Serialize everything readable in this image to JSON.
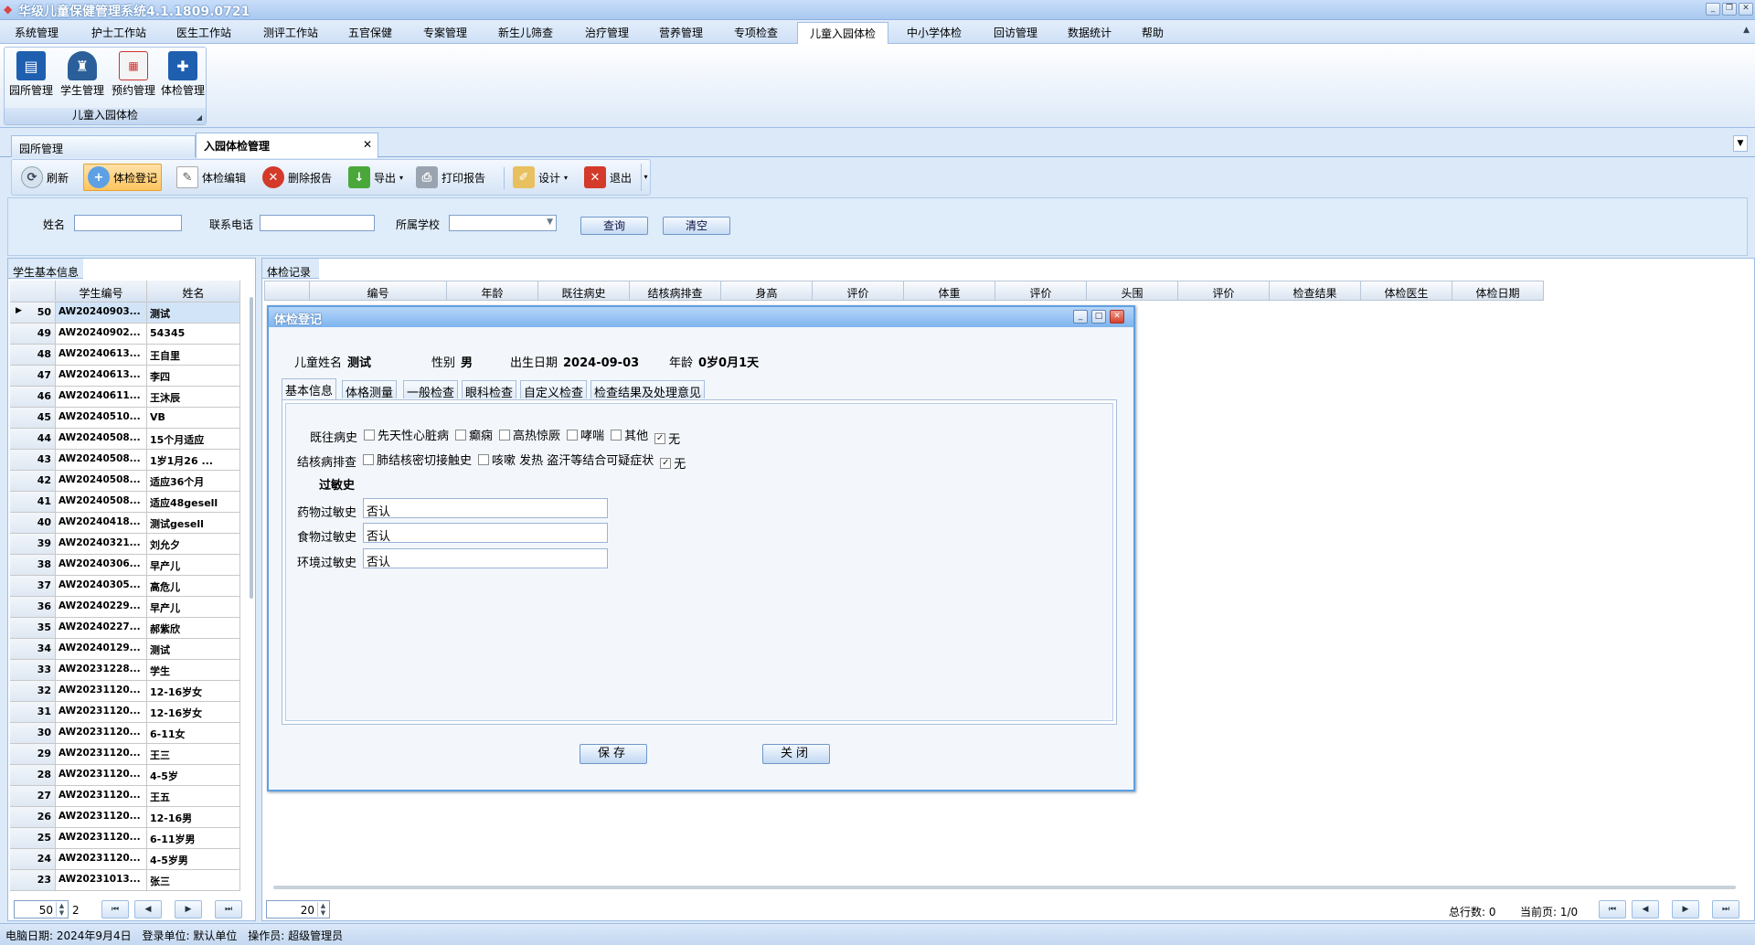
{
  "app": {
    "title": "华级儿童保健管理系统4.1.1809.0721"
  },
  "menu": {
    "items": [
      "系统管理",
      "护士工作站",
      "医生工作站",
      "测评工作站",
      "五官保健",
      "专案管理",
      "新生儿筛查",
      "治疗管理",
      "营养管理",
      "专项检查",
      "儿童入园体检",
      "中小学体检",
      "回访管理",
      "数据统计",
      "帮助"
    ],
    "active": "儿童入园体检"
  },
  "ribbon": {
    "buttons": [
      "园所管理",
      "学生管理",
      "预约管理",
      "体检管理"
    ],
    "group_label": "儿童入园体检"
  },
  "doc_tabs": {
    "tabs": [
      "园所管理",
      "入园体检管理"
    ],
    "active": "入园体检管理"
  },
  "toolbar": {
    "refresh": "刷新",
    "register": "体检登记",
    "edit": "体检编辑",
    "delete": "删除报告",
    "export": "导出",
    "print": "打印报告",
    "design": "设计",
    "exit": "退出"
  },
  "search": {
    "name_label": "姓名",
    "name_value": "",
    "phone_label": "联系电话",
    "phone_value": "",
    "school_label": "所属学校",
    "school_value": "",
    "query_button": "查询",
    "clear_button": "清空"
  },
  "left_panel": {
    "title": "学生基本信息",
    "columns": [
      "学生编号",
      "姓名"
    ],
    "rows": [
      {
        "no": "50",
        "id": "AW20240903...",
        "name": "测试"
      },
      {
        "no": "49",
        "id": "AW20240902...",
        "name": "54345"
      },
      {
        "no": "48",
        "id": "AW20240613...",
        "name": "王自里"
      },
      {
        "no": "47",
        "id": "AW20240613...",
        "name": "李四"
      },
      {
        "no": "46",
        "id": "AW20240611...",
        "name": "王沐辰"
      },
      {
        "no": "45",
        "id": "AW20240510...",
        "name": "VB"
      },
      {
        "no": "44",
        "id": "AW20240508...",
        "name": "15个月适应"
      },
      {
        "no": "43",
        "id": "AW20240508...",
        "name": "1岁1月26 ..."
      },
      {
        "no": "42",
        "id": "AW20240508...",
        "name": "适应36个月"
      },
      {
        "no": "41",
        "id": "AW20240508...",
        "name": "适应48gesell"
      },
      {
        "no": "40",
        "id": "AW20240418...",
        "name": "测试gesell"
      },
      {
        "no": "39",
        "id": "AW20240321...",
        "name": "刘允夕"
      },
      {
        "no": "38",
        "id": "AW20240306...",
        "name": "早产儿"
      },
      {
        "no": "37",
        "id": "AW20240305...",
        "name": "高危儿"
      },
      {
        "no": "36",
        "id": "AW20240229...",
        "name": "早产儿"
      },
      {
        "no": "35",
        "id": "AW20240227...",
        "name": "郝紫欣"
      },
      {
        "no": "34",
        "id": "AW20240129...",
        "name": "测试"
      },
      {
        "no": "33",
        "id": "AW20231228...",
        "name": "学生"
      },
      {
        "no": "32",
        "id": "AW20231120...",
        "name": "12-16岁女"
      },
      {
        "no": "31",
        "id": "AW20231120...",
        "name": "12-16岁女"
      },
      {
        "no": "30",
        "id": "AW20231120...",
        "name": "6-11女"
      },
      {
        "no": "29",
        "id": "AW20231120...",
        "name": "王三"
      },
      {
        "no": "28",
        "id": "AW20231120...",
        "name": "4-5岁"
      },
      {
        "no": "27",
        "id": "AW20231120...",
        "name": "王五"
      },
      {
        "no": "26",
        "id": "AW20231120...",
        "name": "12-16男"
      },
      {
        "no": "25",
        "id": "AW20231120...",
        "name": "6-11岁男"
      },
      {
        "no": "24",
        "id": "AW20231120...",
        "name": "4-5岁男"
      },
      {
        "no": "23",
        "id": "AW20231013...",
        "name": "张三"
      }
    ],
    "page_size": "50",
    "page_count": "2"
  },
  "right_panel": {
    "title": "体检记录",
    "columns": [
      "编号",
      "年龄",
      "既往病史",
      "结核病排查",
      "身高",
      "评价",
      "体重",
      "评价",
      "头围",
      "评价",
      "检查结果",
      "体检医生",
      "体检日期"
    ],
    "page_size": "20",
    "total_label": "总行数: 0",
    "current_page_label": "当前页: 1/0"
  },
  "dialog": {
    "title": "体检登记",
    "child_name_label": "儿童姓名",
    "child_name": "测试",
    "gender_label": "性别",
    "gender": "男",
    "birth_label": "出生日期",
    "birth": "2024-09-03",
    "age_label": "年龄",
    "age": "0岁0月1天",
    "tabs": [
      "基本信息",
      "体格测量",
      "一般检查",
      "眼科检查",
      "自定义检查",
      "检查结果及处理意见"
    ],
    "active_tab": "基本信息",
    "history_label": "既往病史",
    "history_options": [
      {
        "label": "先天性心脏病",
        "checked": false
      },
      {
        "label": "癫痫",
        "checked": false
      },
      {
        "label": "高热惊厥",
        "checked": false
      },
      {
        "label": "哮喘",
        "checked": false
      },
      {
        "label": "其他",
        "checked": false
      },
      {
        "label": "无",
        "checked": true
      }
    ],
    "tb_label": "结核病排查",
    "tb_options": [
      {
        "label": "肺结核密切接触史",
        "checked": false
      },
      {
        "label": "咳嗽 发热 盗汗等结合可疑症状",
        "checked": false
      },
      {
        "label": "无",
        "checked": true
      }
    ],
    "allergy_heading": "过敏史",
    "drug_allergy_label": "药物过敏史",
    "drug_allergy_value": "否认",
    "food_allergy_label": "食物过敏史",
    "food_allergy_value": "否认",
    "env_allergy_label": "环境过敏史",
    "env_allergy_value": "否认",
    "save_button": "保存",
    "close_button": "关闭"
  },
  "status_bar": {
    "date_label": "电脑日期:",
    "date": "2024年9月4日",
    "unit_label": "登录单位:",
    "unit": "默认单位",
    "operator_label": "操作员:",
    "operator": "超级管理员"
  },
  "colors": {
    "accent": "#5f9fe0",
    "ribbon_blue": "#1f5fb0",
    "active_button": "#ffc45e",
    "delete_red": "#d33a2a",
    "export_green": "#4aa83a"
  },
  "icons": {
    "app": "app-logo-icon",
    "ribbon": [
      "kindergarten-book-icon",
      "student-cap-icon",
      "calendar-icon",
      "medical-kit-icon"
    ],
    "toolbar": [
      "refresh-icon",
      "plus-circle-icon",
      "pencil-edit-icon",
      "delete-x-icon",
      "download-arrow-icon",
      "printer-icon",
      "design-pen-icon",
      "exit-icon"
    ]
  }
}
